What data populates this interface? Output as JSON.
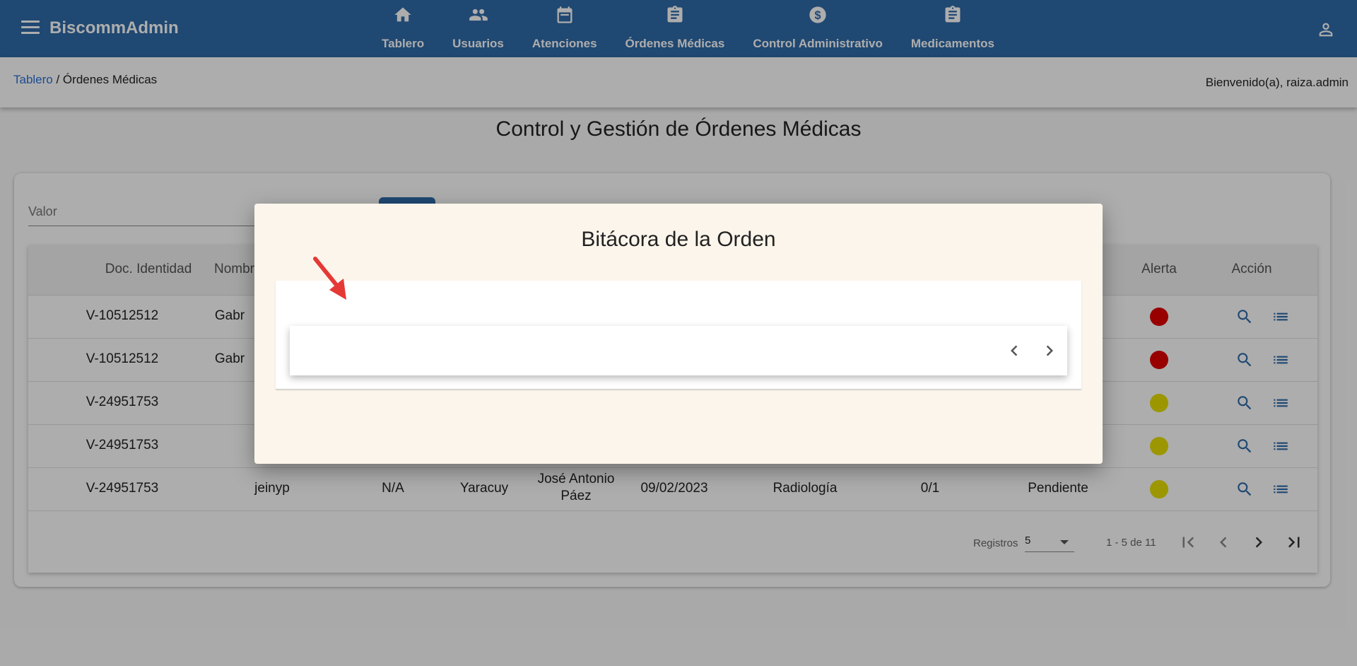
{
  "app": {
    "title": "BiscommAdmin"
  },
  "nav": [
    {
      "label": "Tablero",
      "icon": "home-icon"
    },
    {
      "label": "Usuarios",
      "icon": "people-icon"
    },
    {
      "label": "Atenciones",
      "icon": "calendar-icon"
    },
    {
      "label": "Órdenes Médicas",
      "icon": "clipboard-icon"
    },
    {
      "label": "Control Administrativo",
      "icon": "dollar-icon"
    },
    {
      "label": "Medicamentos",
      "icon": "clipboard-icon"
    }
  ],
  "breadcrumb": {
    "link": "Tablero",
    "current": " / Órdenes Médicas"
  },
  "welcome": "Bienvenido(a), raiza.admin",
  "page": {
    "title": "Control y Gestión de Órdenes Médicas"
  },
  "filter": {
    "placeholder": "Valor"
  },
  "table": {
    "headers": [
      "Doc. Identidad",
      "Nombr",
      "Alerta",
      "Acción"
    ],
    "rows": [
      {
        "doc": "V-10512512",
        "name": "Gabr",
        "alert": "#e00000"
      },
      {
        "doc": "V-10512512",
        "name": "Gabr",
        "alert": "#e00000"
      },
      {
        "doc": "V-24951753",
        "name": "",
        "alert": "#e6df00"
      },
      {
        "doc": "V-24951753",
        "name": "",
        "alert": "#e6df00"
      },
      {
        "doc": "V-24951753",
        "name": "jeinyp",
        "col3": "N/A",
        "col4": "Yaracuy",
        "col5a": "José Antonio",
        "col5b": "Páez",
        "date": "09/02/2023",
        "service": "Radiología",
        "count": "0/1",
        "status": "Pendiente",
        "alert": "#e6df00"
      }
    ]
  },
  "pager": {
    "label": "Registros",
    "size": "5",
    "range": "1 - 5 de 11"
  },
  "dialog": {
    "title": "Bitácora de la Orden"
  },
  "colors": {
    "primary": "#2f6aa8",
    "link": "#2b6fd6",
    "dialog_bg": "#fcf5eb",
    "annotation_arrow": "#e53935"
  }
}
